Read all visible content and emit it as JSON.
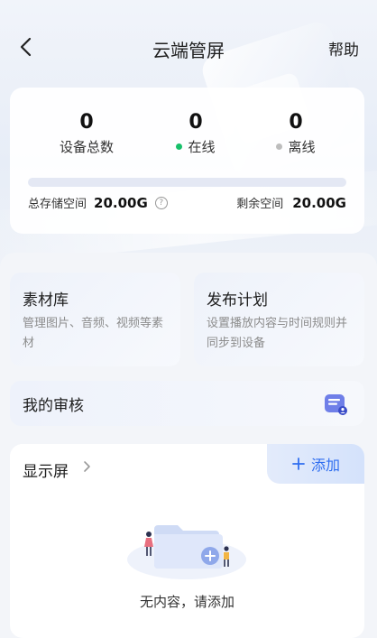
{
  "header": {
    "title": "云端管屏",
    "help_label": "帮助",
    "back_icon": "chevron-left-icon"
  },
  "stats": {
    "total": {
      "value": "0",
      "label": "设备总数"
    },
    "online": {
      "value": "0",
      "label": "在线",
      "dot_color": "#17c06a"
    },
    "offline": {
      "value": "0",
      "label": "离线",
      "dot_color": "#bdbdbd"
    },
    "storage": {
      "total_label": "总存储空间",
      "total_value": "20.00G",
      "remaining_label": "剩余空间",
      "remaining_value": "20.00G",
      "used_fraction": 0,
      "help_icon": "question-circle-icon"
    }
  },
  "tiles": [
    {
      "title": "素材库",
      "desc": "管理图片、音频、视频等素材"
    },
    {
      "title": "发布计划",
      "desc": "设置播放内容与时间规则并同步到设备"
    }
  ],
  "review": {
    "title": "我的审核",
    "icon": "review-document-icon"
  },
  "screens": {
    "title": "显示屏",
    "add_label": "添加",
    "empty_text": "无内容，请添加"
  },
  "colors": {
    "accent": "#2f6ef0",
    "online": "#17c06a",
    "offline": "#bdbdbd"
  }
}
